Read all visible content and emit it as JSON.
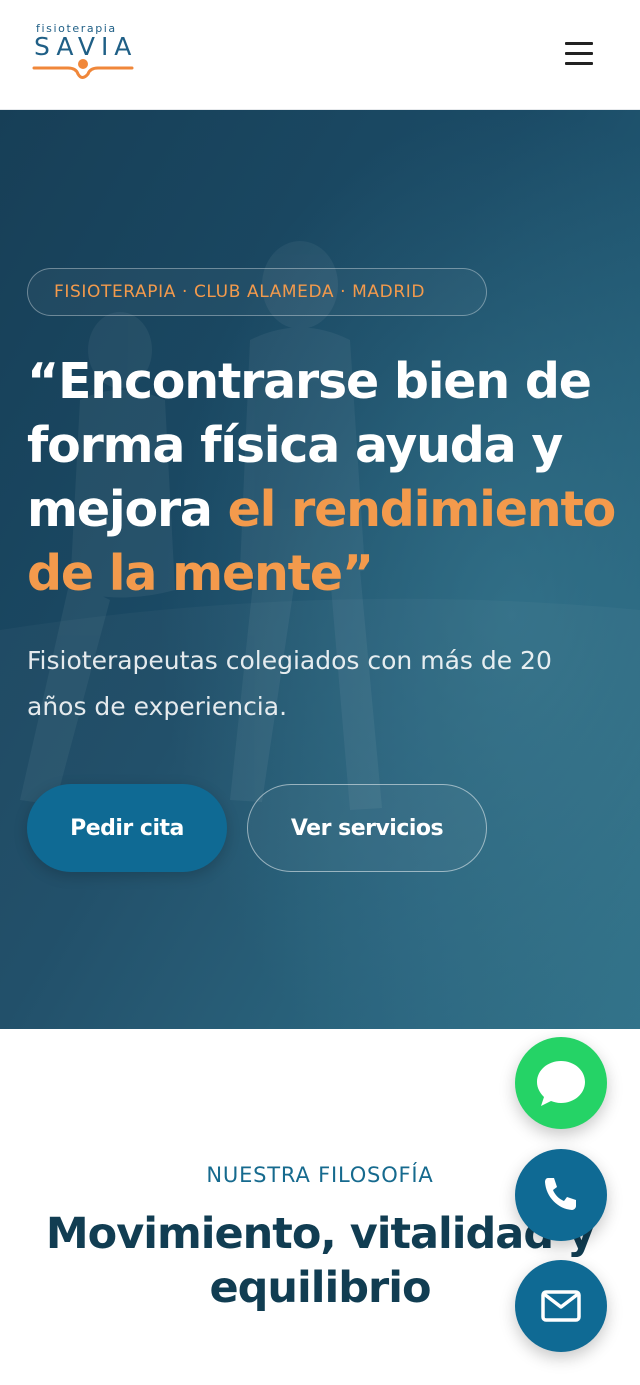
{
  "header": {
    "logo": {
      "top_text": "fisioterapia",
      "brand": "SAVIA"
    },
    "menu_icon": "hamburger-menu-icon"
  },
  "hero": {
    "eyebrow": "FISIOTERAPIA · CLUB ALAMEDA · MADRID",
    "title_white": "“Encontrarse bien de forma física ayuda y mejora ",
    "title_accent": "el rendimiento de la mente”",
    "subtitle": "Fisioterapeutas colegiados con más de 20 años de experiencia.",
    "primary_button": "Pedir cita",
    "secondary_button": "Ver servicios"
  },
  "philosophy": {
    "eyebrow": "NUESTRA FILOSOFÍA",
    "title": "Movimiento, vitalidad y equilibrio"
  },
  "floating_buttons": [
    {
      "icon": "chat-bubble-icon",
      "color": "#25d366"
    },
    {
      "icon": "phone-icon",
      "color": "#0f6a94"
    },
    {
      "icon": "mail-icon",
      "color": "#0f6a94"
    }
  ],
  "colors": {
    "brand_blue": "#1f5f86",
    "accent_orange": "#f39a4c",
    "hero_dark": "#173f57",
    "button_blue": "#0f6a94",
    "heading_dark": "#113d52",
    "whatsapp_green": "#25d366"
  }
}
